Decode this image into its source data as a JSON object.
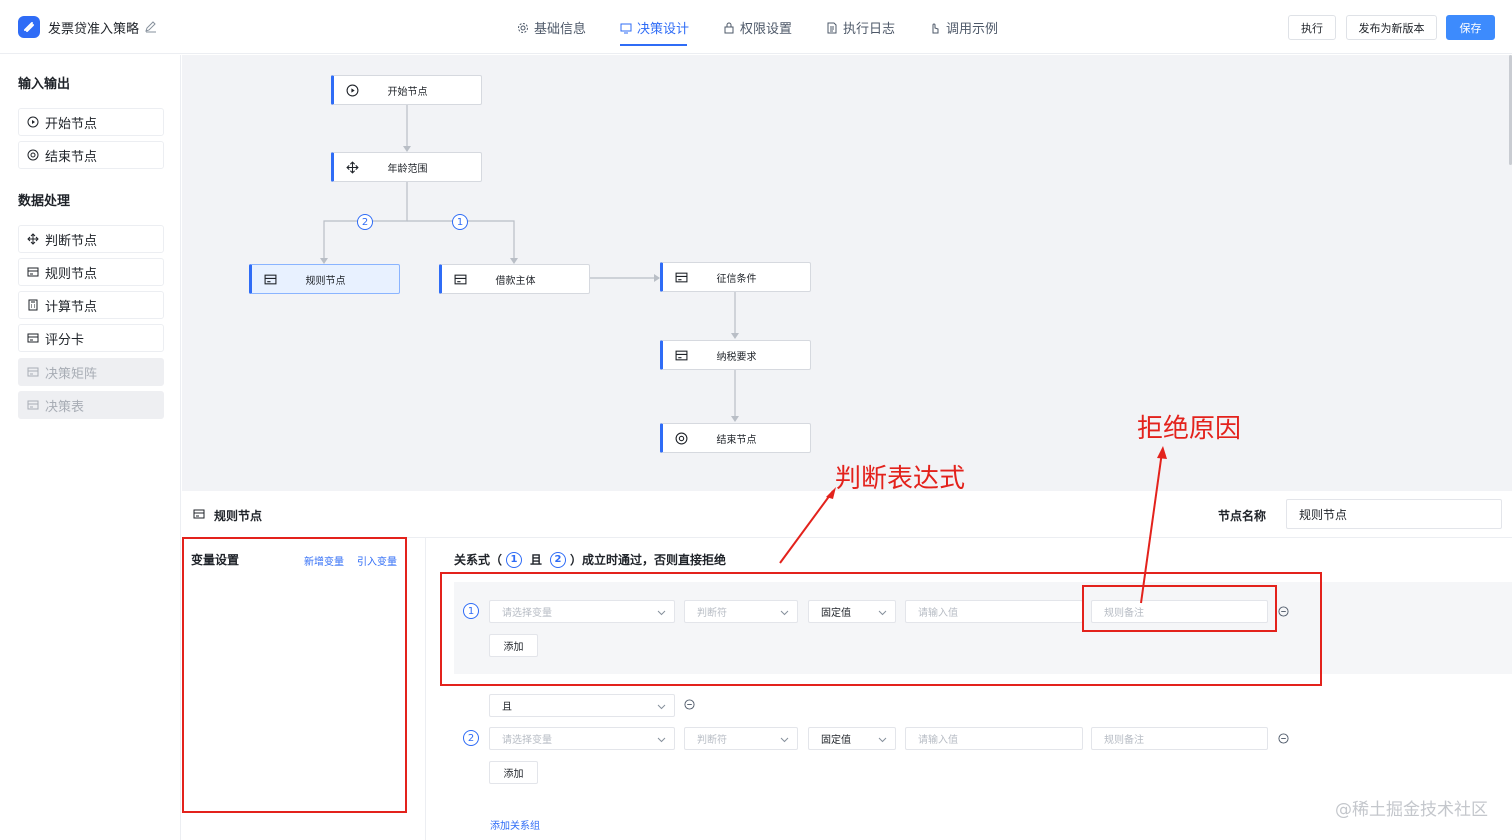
{
  "app": {
    "title": "发票贷准入策略"
  },
  "tabs": [
    {
      "label": "基础信息",
      "icon": "gear-icon"
    },
    {
      "label": "决策设计",
      "icon": "decision-icon",
      "active": true
    },
    {
      "label": "权限设置",
      "icon": "lock-icon"
    },
    {
      "label": "执行日志",
      "icon": "document-icon"
    },
    {
      "label": "调用示例",
      "icon": "hand-pointer-icon"
    }
  ],
  "actions": {
    "run": "执行",
    "publish": "发布为新版本",
    "save": "保存"
  },
  "sidebar": {
    "io_title": "输入输出",
    "io_items": [
      {
        "label": "开始节点",
        "icon": "play-circle-icon"
      },
      {
        "label": "结束节点",
        "icon": "stop-circle-icon"
      }
    ],
    "data_title": "数据处理",
    "data_items": [
      {
        "label": "判断节点",
        "icon": "move-icon",
        "disabled": false
      },
      {
        "label": "规则节点",
        "icon": "card-icon",
        "disabled": false
      },
      {
        "label": "计算节点",
        "icon": "calculator-icon",
        "disabled": false
      },
      {
        "label": "评分卡",
        "icon": "card-icon",
        "disabled": false
      },
      {
        "label": "决策矩阵",
        "icon": "card-icon",
        "disabled": true
      },
      {
        "label": "决策表",
        "icon": "card-icon",
        "disabled": true
      }
    ]
  },
  "flow": {
    "nodes": [
      {
        "id": "start",
        "label": "开始节点",
        "icon": "play-circle-icon"
      },
      {
        "id": "age",
        "label": "年龄范围",
        "icon": "move-icon"
      },
      {
        "id": "rule",
        "label": "规则节点",
        "icon": "card-icon",
        "selected": true
      },
      {
        "id": "borrower",
        "label": "借款主体",
        "icon": "card-icon"
      },
      {
        "id": "credit",
        "label": "征信条件",
        "icon": "card-icon"
      },
      {
        "id": "tax",
        "label": "纳税要求",
        "icon": "card-icon"
      },
      {
        "id": "end",
        "label": "结束节点",
        "icon": "stop-circle-icon"
      }
    ],
    "branch_badges": [
      "2",
      "1"
    ]
  },
  "panel": {
    "title": "规则节点",
    "name_label": "节点名称",
    "name_value": "规则节点",
    "var_title": "变量设置",
    "add_var": "新增变量",
    "import_var": "引入变量",
    "relation": {
      "prefix": "关系式（",
      "n1": "1",
      "and": "且",
      "n2": "2",
      "suffix": "）成立时通过，否则直接拒绝"
    },
    "groups": [
      {
        "num": "1",
        "var_placeholder": "请选择变量",
        "op_placeholder": "判断符",
        "type_value": "固定值",
        "value_placeholder": "请输入值",
        "note_placeholder": "规则备注",
        "add_label": "添加"
      },
      {
        "num": "2",
        "var_placeholder": "请选择变量",
        "op_placeholder": "判断符",
        "type_value": "固定值",
        "value_placeholder": "请输入值",
        "note_placeholder": "规则备注",
        "add_label": "添加"
      }
    ],
    "connector_value": "且",
    "add_group": "添加关系组"
  },
  "annotations": {
    "expr": "判断表达式",
    "reason": "拒绝原因"
  },
  "watermark": "@稀土掘金技术社区",
  "colors": {
    "accent": "#2f6cf6",
    "annotation": "#e3221c",
    "canvas_bg": "#f2f3f6"
  }
}
